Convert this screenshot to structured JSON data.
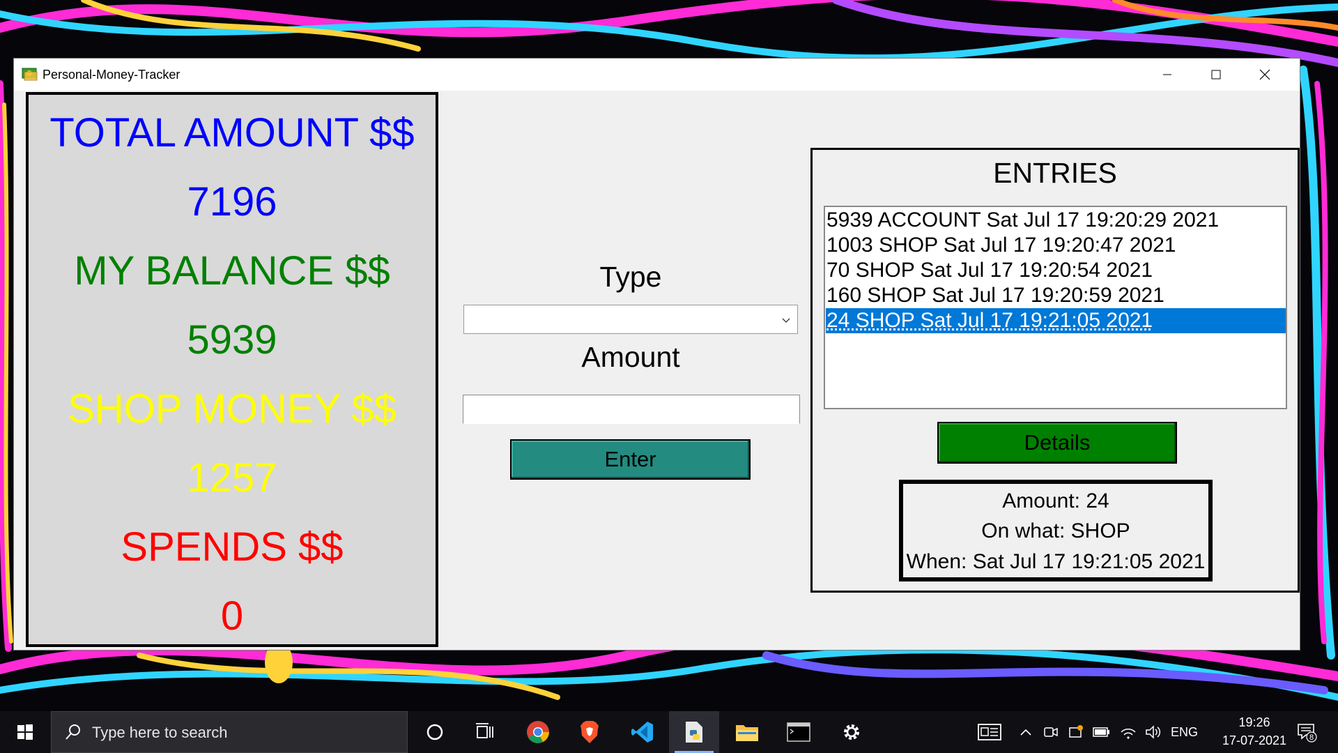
{
  "window": {
    "title": "Personal-Money-Tracker"
  },
  "summary": {
    "total_label": "TOTAL AMOUNT $$",
    "total_value": "7196",
    "balance_label": "MY BALANCE $$",
    "balance_value": "5939",
    "shop_label": "SHOP MONEY $$",
    "shop_value": "1257",
    "spends_label": "SPENDS $$",
    "spends_value": "0",
    "colors": {
      "total": "#0000ff",
      "balance": "#008000",
      "shop": "#ffff00",
      "spends": "#ff0000"
    }
  },
  "form": {
    "type_label": "Type",
    "type_value": "",
    "amount_label": "Amount",
    "amount_value": "",
    "enter_label": "Enter",
    "enter_color": "#238b80"
  },
  "entries": {
    "title": "ENTRIES",
    "items": [
      "5939 ACCOUNT Sat Jul 17 19:20:29 2021",
      "1003 SHOP Sat Jul 17 19:20:47 2021",
      "70 SHOP Sat Jul 17 19:20:54 2021",
      "160 SHOP Sat Jul 17 19:20:59 2021",
      "24 SHOP Sat Jul 17 19:21:05 2021"
    ],
    "selected_index": 4,
    "details_label": "Details",
    "details_color": "#008000"
  },
  "details": {
    "amount_line": "Amount: 24",
    "what_line": "On what: SHOP",
    "when_line": "When: Sat Jul 17 19:21:05 2021"
  },
  "taskbar": {
    "search_placeholder": "Type here to search",
    "language": "ENG",
    "time": "19:26",
    "date": "17-07-2021",
    "notification_count": "8",
    "pinned_icons": [
      "cortana-icon",
      "task-view-icon",
      "chrome-icon",
      "brave-icon",
      "vscode-icon",
      "python-icon",
      "file-explorer-icon",
      "terminal-icon",
      "settings-icon"
    ]
  }
}
